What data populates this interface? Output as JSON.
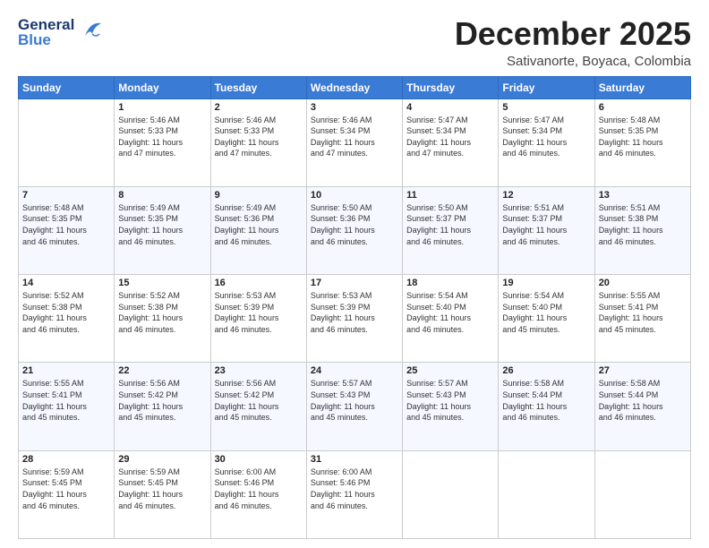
{
  "logo": {
    "line1": "General",
    "line2": "Blue"
  },
  "title": "December 2025",
  "subtitle": "Sativanorte, Boyaca, Colombia",
  "weekdays": [
    "Sunday",
    "Monday",
    "Tuesday",
    "Wednesday",
    "Thursday",
    "Friday",
    "Saturday"
  ],
  "weeks": [
    [
      {
        "day": "",
        "info": ""
      },
      {
        "day": "1",
        "info": "Sunrise: 5:46 AM\nSunset: 5:33 PM\nDaylight: 11 hours\nand 47 minutes."
      },
      {
        "day": "2",
        "info": "Sunrise: 5:46 AM\nSunset: 5:33 PM\nDaylight: 11 hours\nand 47 minutes."
      },
      {
        "day": "3",
        "info": "Sunrise: 5:46 AM\nSunset: 5:34 PM\nDaylight: 11 hours\nand 47 minutes."
      },
      {
        "day": "4",
        "info": "Sunrise: 5:47 AM\nSunset: 5:34 PM\nDaylight: 11 hours\nand 47 minutes."
      },
      {
        "day": "5",
        "info": "Sunrise: 5:47 AM\nSunset: 5:34 PM\nDaylight: 11 hours\nand 46 minutes."
      },
      {
        "day": "6",
        "info": "Sunrise: 5:48 AM\nSunset: 5:35 PM\nDaylight: 11 hours\nand 46 minutes."
      }
    ],
    [
      {
        "day": "7",
        "info": "Sunrise: 5:48 AM\nSunset: 5:35 PM\nDaylight: 11 hours\nand 46 minutes."
      },
      {
        "day": "8",
        "info": "Sunrise: 5:49 AM\nSunset: 5:35 PM\nDaylight: 11 hours\nand 46 minutes."
      },
      {
        "day": "9",
        "info": "Sunrise: 5:49 AM\nSunset: 5:36 PM\nDaylight: 11 hours\nand 46 minutes."
      },
      {
        "day": "10",
        "info": "Sunrise: 5:50 AM\nSunset: 5:36 PM\nDaylight: 11 hours\nand 46 minutes."
      },
      {
        "day": "11",
        "info": "Sunrise: 5:50 AM\nSunset: 5:37 PM\nDaylight: 11 hours\nand 46 minutes."
      },
      {
        "day": "12",
        "info": "Sunrise: 5:51 AM\nSunset: 5:37 PM\nDaylight: 11 hours\nand 46 minutes."
      },
      {
        "day": "13",
        "info": "Sunrise: 5:51 AM\nSunset: 5:38 PM\nDaylight: 11 hours\nand 46 minutes."
      }
    ],
    [
      {
        "day": "14",
        "info": "Sunrise: 5:52 AM\nSunset: 5:38 PM\nDaylight: 11 hours\nand 46 minutes."
      },
      {
        "day": "15",
        "info": "Sunrise: 5:52 AM\nSunset: 5:38 PM\nDaylight: 11 hours\nand 46 minutes."
      },
      {
        "day": "16",
        "info": "Sunrise: 5:53 AM\nSunset: 5:39 PM\nDaylight: 11 hours\nand 46 minutes."
      },
      {
        "day": "17",
        "info": "Sunrise: 5:53 AM\nSunset: 5:39 PM\nDaylight: 11 hours\nand 46 minutes."
      },
      {
        "day": "18",
        "info": "Sunrise: 5:54 AM\nSunset: 5:40 PM\nDaylight: 11 hours\nand 46 minutes."
      },
      {
        "day": "19",
        "info": "Sunrise: 5:54 AM\nSunset: 5:40 PM\nDaylight: 11 hours\nand 45 minutes."
      },
      {
        "day": "20",
        "info": "Sunrise: 5:55 AM\nSunset: 5:41 PM\nDaylight: 11 hours\nand 45 minutes."
      }
    ],
    [
      {
        "day": "21",
        "info": "Sunrise: 5:55 AM\nSunset: 5:41 PM\nDaylight: 11 hours\nand 45 minutes."
      },
      {
        "day": "22",
        "info": "Sunrise: 5:56 AM\nSunset: 5:42 PM\nDaylight: 11 hours\nand 45 minutes."
      },
      {
        "day": "23",
        "info": "Sunrise: 5:56 AM\nSunset: 5:42 PM\nDaylight: 11 hours\nand 45 minutes."
      },
      {
        "day": "24",
        "info": "Sunrise: 5:57 AM\nSunset: 5:43 PM\nDaylight: 11 hours\nand 45 minutes."
      },
      {
        "day": "25",
        "info": "Sunrise: 5:57 AM\nSunset: 5:43 PM\nDaylight: 11 hours\nand 45 minutes."
      },
      {
        "day": "26",
        "info": "Sunrise: 5:58 AM\nSunset: 5:44 PM\nDaylight: 11 hours\nand 46 minutes."
      },
      {
        "day": "27",
        "info": "Sunrise: 5:58 AM\nSunset: 5:44 PM\nDaylight: 11 hours\nand 46 minutes."
      }
    ],
    [
      {
        "day": "28",
        "info": "Sunrise: 5:59 AM\nSunset: 5:45 PM\nDaylight: 11 hours\nand 46 minutes."
      },
      {
        "day": "29",
        "info": "Sunrise: 5:59 AM\nSunset: 5:45 PM\nDaylight: 11 hours\nand 46 minutes."
      },
      {
        "day": "30",
        "info": "Sunrise: 6:00 AM\nSunset: 5:46 PM\nDaylight: 11 hours\nand 46 minutes."
      },
      {
        "day": "31",
        "info": "Sunrise: 6:00 AM\nSunset: 5:46 PM\nDaylight: 11 hours\nand 46 minutes."
      },
      {
        "day": "",
        "info": ""
      },
      {
        "day": "",
        "info": ""
      },
      {
        "day": "",
        "info": ""
      }
    ]
  ]
}
